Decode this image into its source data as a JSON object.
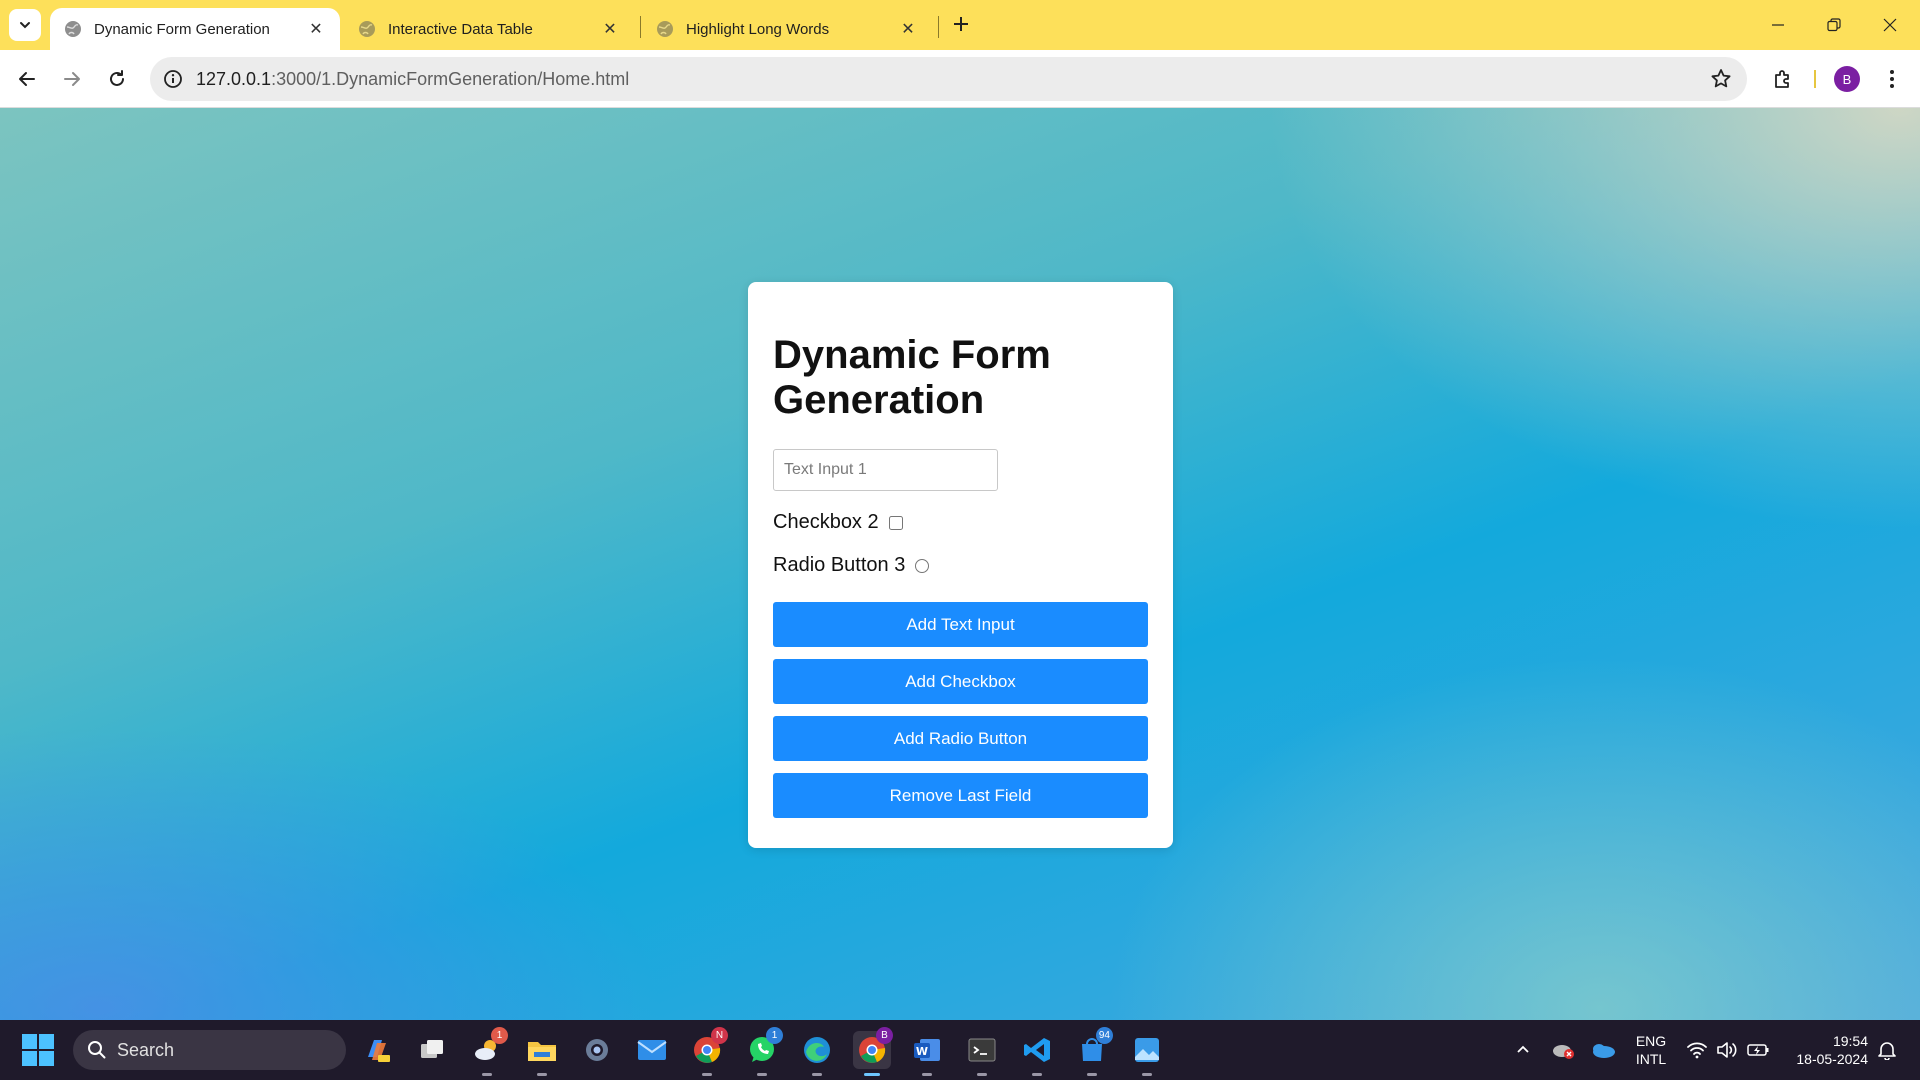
{
  "browser": {
    "tabs": [
      {
        "title": "Dynamic Form Generation",
        "active": true
      },
      {
        "title": "Interactive Data Table",
        "active": false
      },
      {
        "title": "Highlight Long Words",
        "active": false
      }
    ],
    "url_host": "127.0.0.1",
    "url_path": ":3000/1.DynamicFormGeneration/Home.html",
    "profile_initial": "B",
    "accent_color": "#fde05a"
  },
  "form": {
    "title": "Dynamic Form Generation",
    "text_input_placeholder": "Text Input 1",
    "checkbox_label": "Checkbox 2",
    "radio_label": "Radio Button 3",
    "buttons": {
      "add_text": "Add Text Input",
      "add_checkbox": "Add Checkbox",
      "add_radio": "Add Radio Button",
      "remove_last": "Remove Last Field"
    },
    "button_color": "#1a8cff"
  },
  "taskbar": {
    "search_label": "Search",
    "badges": {
      "weather": "1",
      "chrome_profile": "N",
      "whatsapp": "1",
      "chrome_active": "B",
      "store": "94"
    },
    "language": {
      "line1": "ENG",
      "line2": "INTL"
    },
    "time": "19:54",
    "date": "18-05-2024"
  }
}
